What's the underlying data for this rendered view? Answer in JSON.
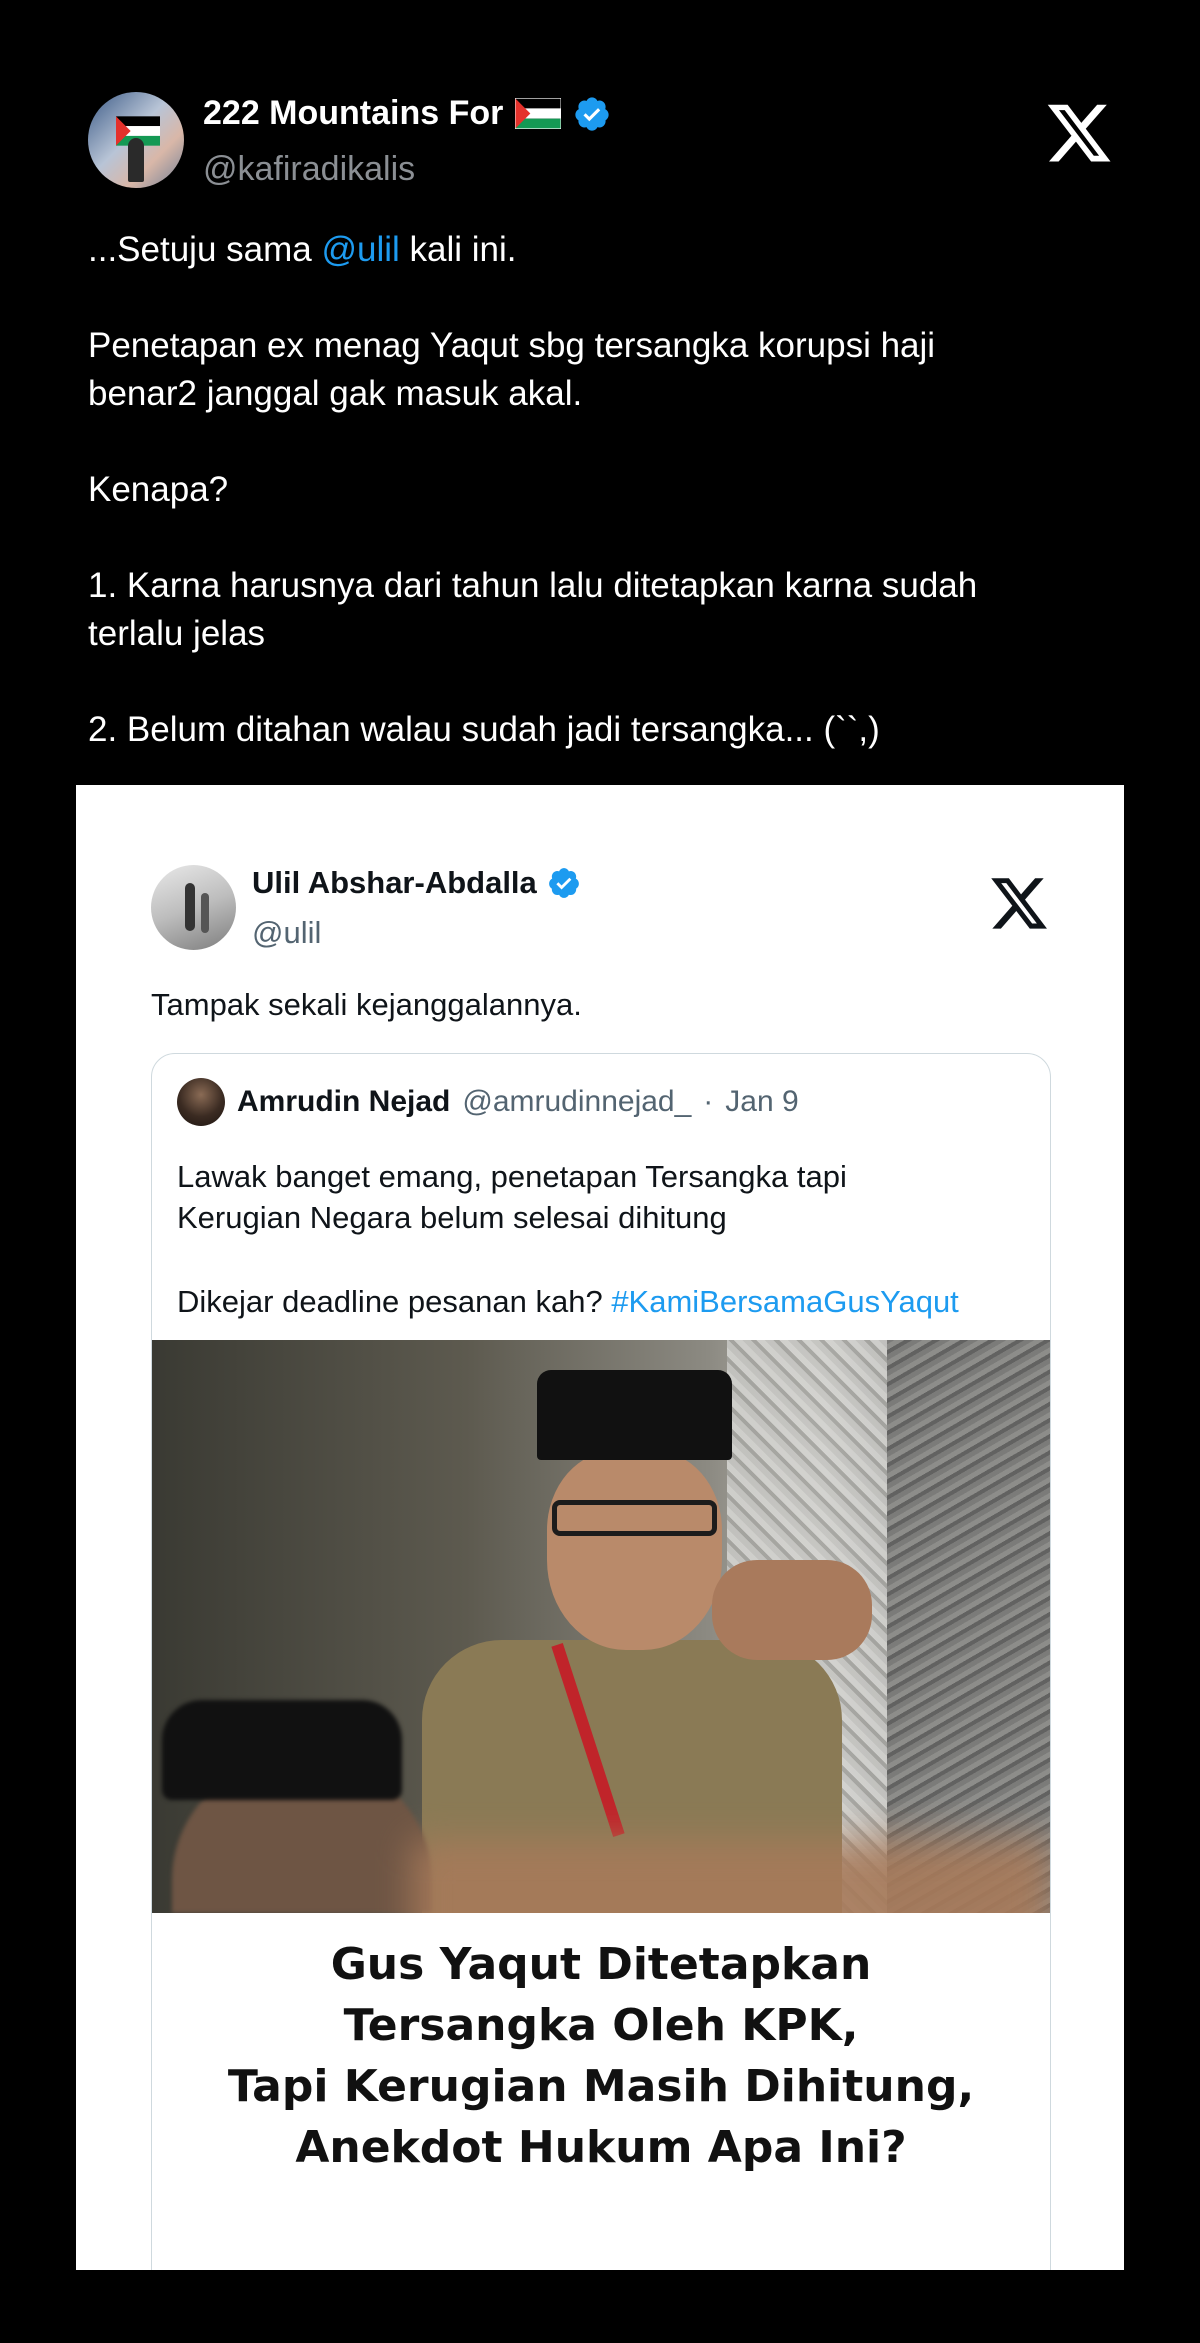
{
  "outer_tweet": {
    "display_name": "222 Mountains For",
    "handle": "@kafiradikalis",
    "verified": true,
    "body": {
      "line1_prefix": "...Setuju sama ",
      "line1_mention": "@ulil",
      "line1_suffix": " kali ini.",
      "para2_line1": "Penetapan ex menag Yaqut sbg tersangka korupsi haji",
      "para2_line2": "benar2 janggal gak masuk akal.",
      "para3": "Kenapa?",
      "point1_line1": "1. Karna harusnya dari tahun lalu ditetapkan karna sudah",
      "point1_line2": "terlalu jelas",
      "point2": "2. Belum ditahan walau sudah jadi tersangka... (``,)"
    }
  },
  "embedded_tweet": {
    "display_name": "Ulil Abshar-Abdalla",
    "handle": "@ulil",
    "verified": true,
    "text": "Tampak sekali kejanggalannya.",
    "quoted": {
      "display_name": "Amrudin Nejad",
      "handle": "@amrudinnejad_",
      "dot": "·",
      "date": "Jan 9",
      "text_line1": "Lawak banget emang, penetapan Tersangka tapi",
      "text_line2": "Kerugian Negara belum selesai dihitung",
      "text_line3_prefix": "Dikejar deadline pesanan kah? ",
      "hashtag": "#KamiBersamaGusYaqut",
      "headline_lines": [
        "Gus Yaqut Ditetapkan",
        "Tersangka Oleh KPK,",
        "Tapi Kerugian Masih Dihitung,",
        "Anekdot Hukum Apa Ini?"
      ]
    }
  },
  "colors": {
    "background": "#000000",
    "link_blue": "#1d9bf0",
    "verified_blue": "#1d9bf0",
    "card_bg": "#ffffff"
  },
  "icons": [
    "x-logo-icon",
    "verified-badge-icon",
    "palestine-flag-icon"
  ]
}
